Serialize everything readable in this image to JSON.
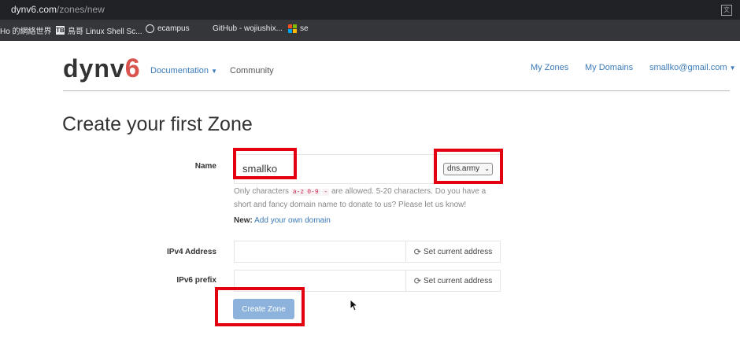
{
  "browser": {
    "url_host": "dynv6.com",
    "url_path": "/zones/new",
    "bookmarks": [
      {
        "label": "Ho 的網絡世界",
        "icon": "none"
      },
      {
        "label": "鳥哥 Linux Shell Sc...",
        "icon": "tb-icon",
        "icon_text": "TB"
      },
      {
        "label": "ecampus",
        "icon": "globe-icon"
      },
      {
        "label": "GitHub - wojiushix...",
        "icon": "none"
      },
      {
        "label": "se",
        "icon": "microsoft-icon"
      }
    ]
  },
  "site": {
    "logo_main": "dynv",
    "logo_accent": "6",
    "logo_accent_color": "#d9534f",
    "nav": {
      "documentation": "Documentation",
      "community": "Community",
      "my_zones": "My Zones",
      "my_domains": "My Domains",
      "user": "smallko@gmail.com"
    }
  },
  "form": {
    "title": "Create your first Zone",
    "name_label": "Name",
    "name_value": "smallko",
    "domain_select": "dns.army",
    "help_pre": "Only characters",
    "help_code1": "a-z",
    "help_code2": "0-9",
    "help_code3": "-",
    "help_post": "are allowed. 5-20 characters. Do you have a short and fancy domain name to donate to us? Please let us know!",
    "new_label": "New:",
    "new_link": "Add your own domain",
    "ipv4_label": "IPv4 Address",
    "ipv4_value": "",
    "ipv6_label": "IPv6 prefix",
    "ipv6_value": "",
    "set_current": "Set current address",
    "submit": "Create Zone"
  },
  "colors": {
    "highlight": "#e3000f",
    "link": "#3a7ab8",
    "button": "#8db3dc"
  }
}
